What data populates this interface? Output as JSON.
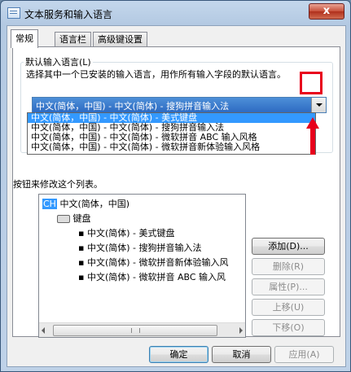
{
  "window": {
    "title": "文本服务和输入语言",
    "close_glyph": "x"
  },
  "tabs": [
    {
      "label": "常规"
    },
    {
      "label": "语言栏"
    },
    {
      "label": "高级键设置"
    }
  ],
  "default_group": {
    "title": "默认输入语言(L)",
    "description": "选择其中一个已安装的输入语言，用作所有输入字段的默认语言。",
    "selected_value": "中文(简体，中国) - 中文(简体) - 搜狗拼音输入法",
    "options": [
      "中文(简体，中国) - 中文(简体) - 美式键盘",
      "中文(简体，中国) - 中文(简体) - 搜狗拼音输入法",
      "中文(简体，中国) - 中文(简体) - 微软拼音 ABC 输入风格",
      "中文(简体，中国) - 中文(简体) - 微软拼音新体验输入风格"
    ]
  },
  "services_hint": "按钮来修改这个列表。",
  "tree": {
    "lang_badge": "CH",
    "language": "中文(简体，中国)",
    "category": "键盘",
    "items": [
      "中文(简体) - 美式键盘",
      "中文(简体) - 搜狗拼音输入法",
      "中文(简体) - 微软拼音新体验输入风",
      "中文(简体) - 微软拼音 ABC 输入风"
    ]
  },
  "side_buttons": {
    "add": "添加(D)...",
    "remove": "删除(R)",
    "properties": "属性(P)...",
    "move_up": "上移(U)",
    "move_down": "下移(O)"
  },
  "footer": {
    "ok": "确定",
    "cancel": "取消",
    "apply": "应用(A)"
  },
  "colors": {
    "selection": "#3399ff",
    "highlight_box": "#e8001c",
    "title_bar": "#b3c9e2"
  }
}
